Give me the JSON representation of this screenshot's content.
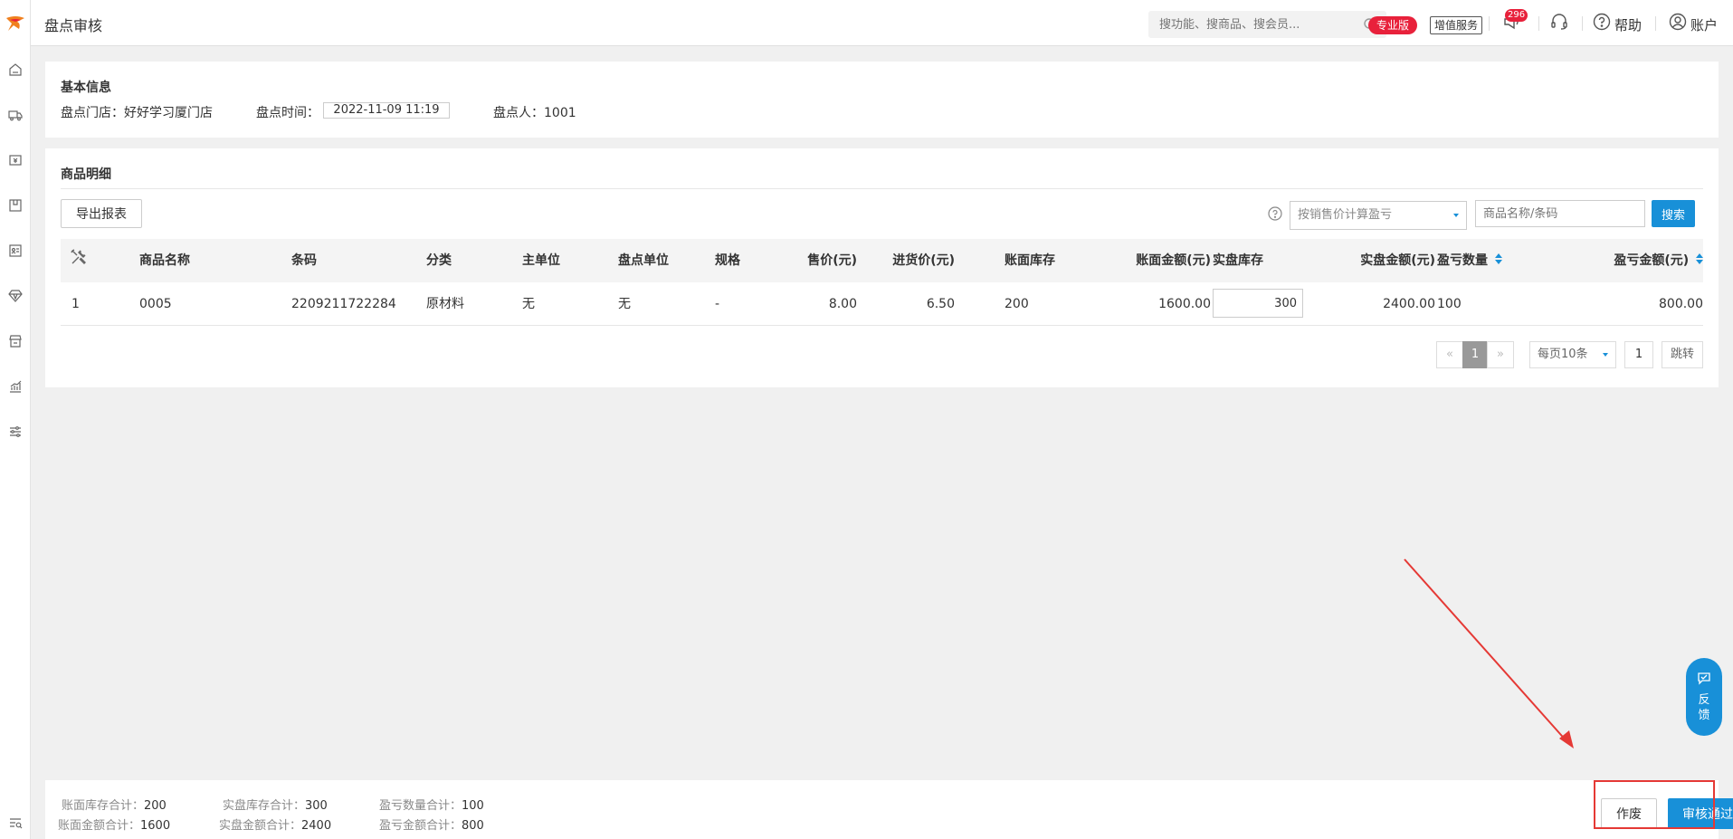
{
  "header": {
    "page_title": "盘点审核",
    "search_placeholder": "搜功能、搜商品、搜会员...",
    "pro_badge": "专业版",
    "value_service": "增值服务",
    "message_count": "296",
    "help_label": "帮助",
    "account_label": "账户"
  },
  "sidebar": {
    "icons": [
      "home-icon",
      "truck-icon",
      "cashier-icon",
      "inventory-icon",
      "member-card-icon",
      "diamond-icon",
      "store-icon",
      "chart-icon",
      "settings-sliders-icon",
      "search-list-icon"
    ]
  },
  "basic_info": {
    "title": "基本信息",
    "store_label": "盘点门店：",
    "store_value": "好好学习厦门店",
    "time_label": "盘点时间：",
    "time_value": "2022-11-09 11:19",
    "person_label": "盘点人：",
    "person_value": "1001"
  },
  "details": {
    "title": "商品明细",
    "export_button": "导出报表",
    "calc_select": "按销售价计算盈亏",
    "name_placeholder": "商品名称/条码",
    "search_button": "搜索",
    "columns": [
      "商品名称",
      "条码",
      "分类",
      "主单位",
      "盘点单位",
      "规格",
      "售价(元)",
      "进货价(元)",
      "账面库存",
      "账面金额(元)",
      "实盘库存",
      "实盘金额(元)",
      "盈亏数量",
      "盈亏金额(元)"
    ],
    "rows": [
      {
        "index": "1",
        "name": "0005",
        "barcode": "2209211722284",
        "category": "原材料",
        "main_unit": "无",
        "count_unit": "无",
        "spec": "-",
        "price": "8.00",
        "cost": "6.50",
        "book_stock": "200",
        "book_amount": "1600.00",
        "actual_stock": "300",
        "actual_amount": "2400.00",
        "diff_qty": "100",
        "diff_amount": "800.00"
      }
    ]
  },
  "pagination": {
    "prev": "«",
    "current": "1",
    "next": "»",
    "page_size": "每页10条",
    "jump_value": "1",
    "jump_button": "跳转"
  },
  "summary": {
    "book_stock_label": "账面库存合计：",
    "book_stock": "200",
    "book_amount_label": "账面金额合计：",
    "book_amount": "1600",
    "actual_stock_label": "实盘库存合计：",
    "actual_stock": "300",
    "actual_amount_label": "实盘金额合计：",
    "actual_amount": "2400",
    "diff_qty_label": "盈亏数量合计：",
    "diff_qty": "100",
    "diff_amount_label": "盈亏金额合计：",
    "diff_amount": "800"
  },
  "actions": {
    "void_button": "作废",
    "approve_button": "审核通过"
  },
  "feedback": {
    "label_1": "反",
    "label_2": "馈"
  },
  "colors": {
    "primary": "#1890d8",
    "badge_red": "#e8213b",
    "annotation_red": "#e53935"
  }
}
